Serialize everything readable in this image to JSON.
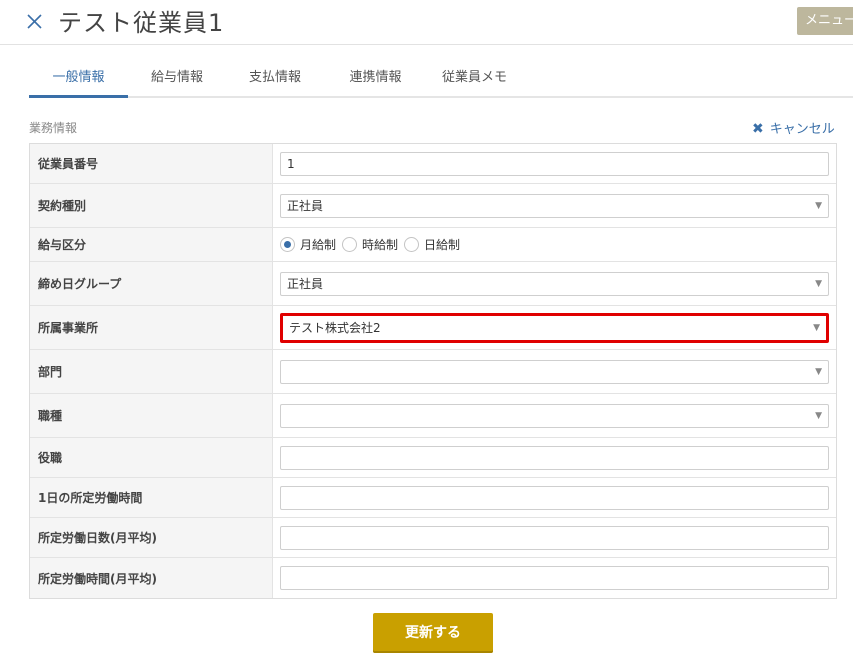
{
  "header": {
    "title": "テスト従業員1",
    "menu_label": "メニュー"
  },
  "tabs": [
    {
      "label": "一般情報",
      "active": true
    },
    {
      "label": "給与情報",
      "active": false
    },
    {
      "label": "支払情報",
      "active": false
    },
    {
      "label": "連携情報",
      "active": false
    },
    {
      "label": "従業員メモ",
      "active": false
    }
  ],
  "section": {
    "label": "業務情報",
    "cancel_label": "キャンセル"
  },
  "form": {
    "employee_number": {
      "label": "従業員番号",
      "value": "1"
    },
    "contract_type": {
      "label": "契約種別",
      "value": "正社員"
    },
    "pay_type": {
      "label": "給与区分",
      "options": [
        "月給制",
        "時給制",
        "日給制"
      ],
      "selected": "月給制"
    },
    "closing_group": {
      "label": "締め日グループ",
      "value": "正社員"
    },
    "office": {
      "label": "所属事業所",
      "value": "テスト株式会社2"
    },
    "department": {
      "label": "部門",
      "value": ""
    },
    "job_type": {
      "label": "職種",
      "value": ""
    },
    "position": {
      "label": "役職",
      "value": ""
    },
    "daily_hours": {
      "label": "1日の所定労働時間",
      "value": ""
    },
    "monthly_days": {
      "label": "所定労働日数(月平均)",
      "value": ""
    },
    "monthly_hours": {
      "label": "所定労働時間(月平均)",
      "value": ""
    }
  },
  "submit_label": "更新する",
  "colors": {
    "accent": "#3a6fa8",
    "submit": "#c9a000",
    "highlight": "#e00000",
    "menu": "#bdb79d"
  }
}
